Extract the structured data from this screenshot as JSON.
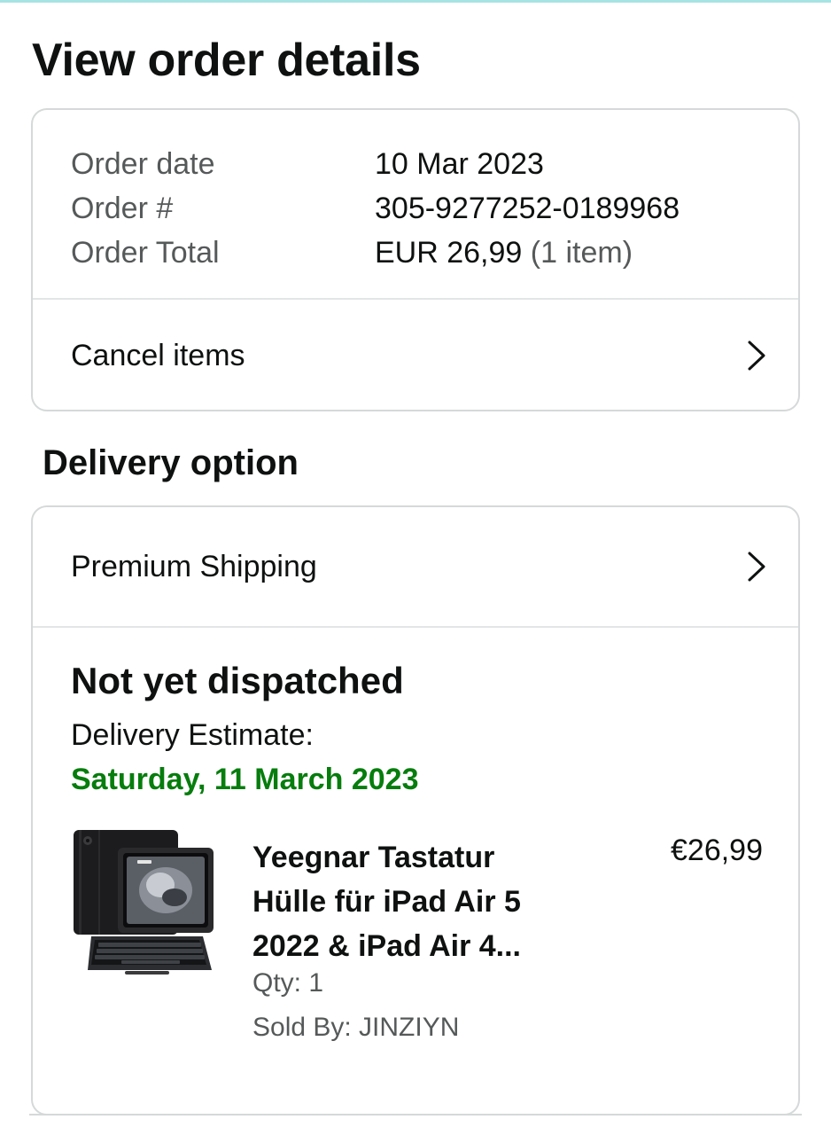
{
  "page": {
    "title": "View order details"
  },
  "summary": {
    "rows": [
      {
        "label": "Order date",
        "value": "10 Mar 2023"
      },
      {
        "label": "Order #",
        "value": "305-9277252-0189968"
      },
      {
        "label": "Order Total",
        "value": "EUR 26,99",
        "extra": "(1 item)"
      }
    ],
    "cancel_label": "Cancel items"
  },
  "delivery": {
    "section_title": "Delivery option",
    "shipping_label": "Premium Shipping",
    "status": "Not yet dispatched",
    "estimate_label": "Delivery Estimate:",
    "estimate_date": "Saturday, 11 March 2023",
    "estimate_color": "#067d0d",
    "item": {
      "title_line1": "Yeegnar Tastatur",
      "title_line2": "Hülle für iPad Air 5",
      "title_line3": "2022 & iPad Air 4...",
      "price": "€26,99",
      "qty": "Qty: 1",
      "seller": "Sold By: JINZIYN",
      "image_icon": "tablet-keyboard-case-image"
    }
  },
  "icons": {
    "chevron": "chevron-right-icon"
  }
}
